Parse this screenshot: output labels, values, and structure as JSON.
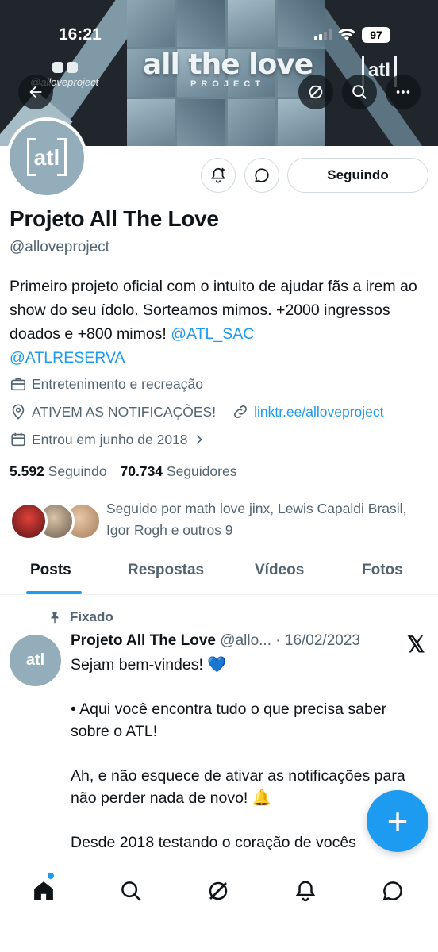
{
  "status_bar": {
    "time": "16:21",
    "battery": "97"
  },
  "banner": {
    "title": "all the love",
    "subtitle": "PROJECT",
    "handle": "@alloveproject",
    "logo_text": "atl"
  },
  "header_buttons": [
    "back-icon",
    "grok-icon",
    "search-icon",
    "more-icon"
  ],
  "profile": {
    "avatar_text": "atl",
    "name": "Projeto All The Love",
    "handle": "@alloveproject",
    "bio_text": "Primeiro projeto oficial com o intuito de ajudar fãs a irem ao show do seu ídolo. Sorteamos mimos. +2000 ingressos doados e +800 mimos! ",
    "bio_link1": "@ATL_SAC",
    "bio_link2": "@ATLRESERVA",
    "category": "Entretenimento e recreação",
    "location": "ATIVEM AS NOTIFICAÇÕES!",
    "website": "linktr.ee/alloveproject",
    "joined": "Entrou em junho de 2018",
    "following_count": "5.592",
    "following_label": "Seguindo",
    "followers_count": "70.734",
    "followers_label": "Seguidores",
    "followed_by": "Seguido por math love jinx, Lewis Capaldi Brasil, Igor Rogh e outros 9"
  },
  "actions": {
    "follow_button": "Seguindo"
  },
  "tabs": [
    {
      "label": "Posts",
      "active": true
    },
    {
      "label": "Respostas",
      "active": false
    },
    {
      "label": "Vídeos",
      "active": false
    },
    {
      "label": "Fotos",
      "active": false
    }
  ],
  "pinned_tweet": {
    "pinned_label": "Fixado",
    "author_name": "Projeto All The Love",
    "author_handle": "@allo...",
    "date": "· 16/02/2023",
    "line1": "Sejam bem-vindes! 💙",
    "line2": "•  Aqui você encontra tudo o que precisa saber sobre o ATL!",
    "line3": "Ah, e não esquece de ativar as notificações para não perder nada de novo!  🔔",
    "line4": "Desde 2018 testando o coração de vocês"
  },
  "fab": {
    "label": "+"
  },
  "bottom_nav": [
    "home-icon",
    "search-icon",
    "grok-icon",
    "notifications-icon",
    "messages-icon"
  ],
  "colors": {
    "accent": "#1d9bf0",
    "text": "#0f1419",
    "secondary": "#536471",
    "avatar_bg": "#93adbb"
  }
}
